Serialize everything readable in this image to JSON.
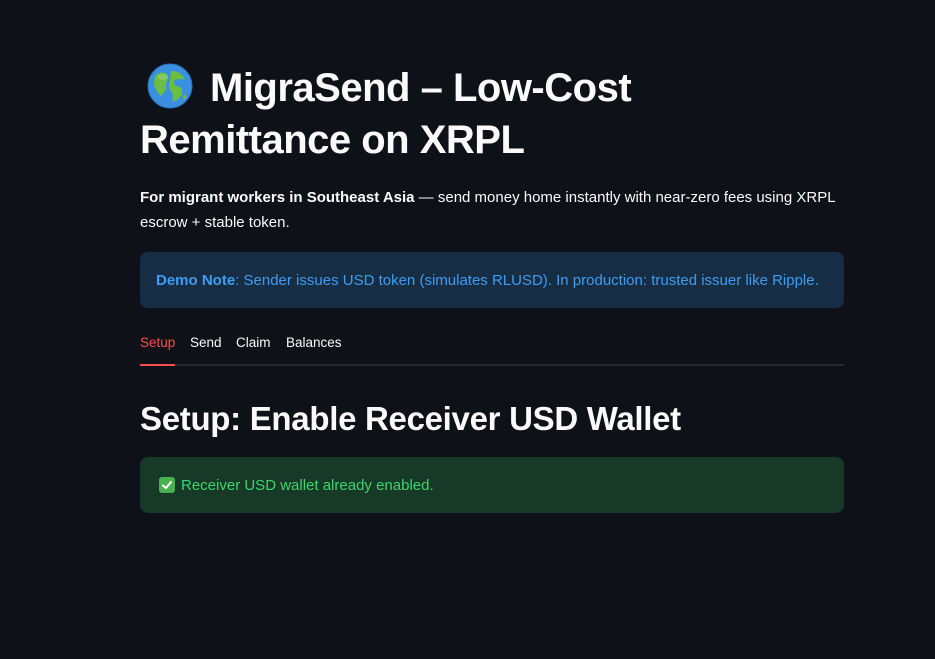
{
  "header": {
    "title": "MigraSend – Low-Cost Remittance on XRPL",
    "title_icon": "globe-icon",
    "subtitle_bold": "For migrant workers in Southeast Asia",
    "subtitle_rest": " — send money home instantly with near-zero fees using XRPL escrow + stable token."
  },
  "demo_note": {
    "label": "Demo Note",
    "text": ": Sender issues USD token (simulates RLUSD). In production: trusted issuer like Ripple."
  },
  "tabs": [
    {
      "label": "Setup",
      "active": true
    },
    {
      "label": "Send",
      "active": false
    },
    {
      "label": "Claim",
      "active": false
    },
    {
      "label": "Balances",
      "active": false
    }
  ],
  "setup": {
    "heading": "Setup: Enable Receiver USD Wallet",
    "status_icon": "check-box-icon",
    "status_text": "Receiver USD wallet already enabled."
  },
  "colors": {
    "background": "#0e1117",
    "accent": "#ff4b4b",
    "info_bg": "#172d43",
    "info_text": "#3d9df3",
    "success_bg": "#173928",
    "success_text": "#3dd56d"
  }
}
